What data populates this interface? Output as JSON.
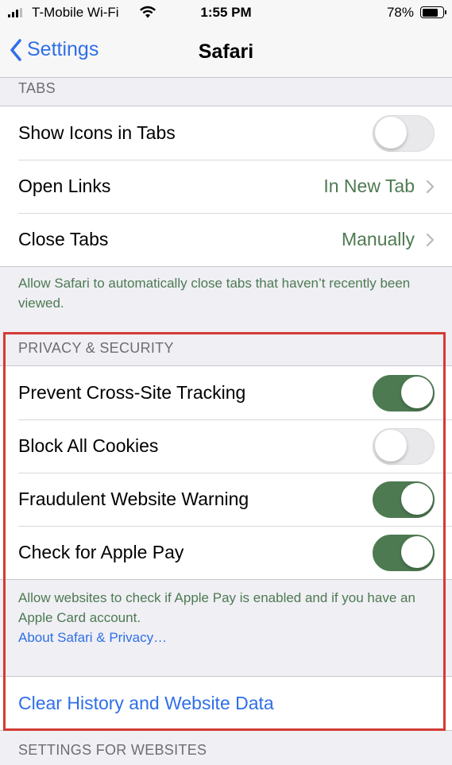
{
  "status_bar": {
    "carrier": "T-Mobile Wi-Fi",
    "time": "1:55 PM",
    "battery": "78%",
    "battery_level": 0.78
  },
  "nav": {
    "back_label": "Settings",
    "title": "Safari"
  },
  "tabs_section": {
    "header": "TABS",
    "rows": [
      {
        "label": "Show Icons in Tabs",
        "toggle": false
      },
      {
        "label": "Open Links",
        "value": "In New Tab"
      },
      {
        "label": "Close Tabs",
        "value": "Manually"
      }
    ],
    "footer": "Allow Safari to automatically close tabs that haven’t recently been viewed."
  },
  "privacy_section": {
    "header": "PRIVACY & SECURITY",
    "rows": [
      {
        "label": "Prevent Cross-Site Tracking",
        "toggle": true
      },
      {
        "label": "Block All Cookies",
        "toggle": false
      },
      {
        "label": "Fraudulent Website Warning",
        "toggle": true
      },
      {
        "label": "Check for Apple Pay",
        "toggle": true
      }
    ],
    "footer": "Allow websites to check if Apple Pay is enabled and if you have an Apple Card account.",
    "footer_link": "About Safari & Privacy…"
  },
  "clear_history": {
    "label": "Clear History and Website Data"
  },
  "websites_section": {
    "header": "SETTINGS FOR WEBSITES"
  },
  "colors": {
    "accent_blue": "#2f6fe8",
    "toggle_on": "#4e7a52",
    "highlight_border": "#d33b34"
  }
}
